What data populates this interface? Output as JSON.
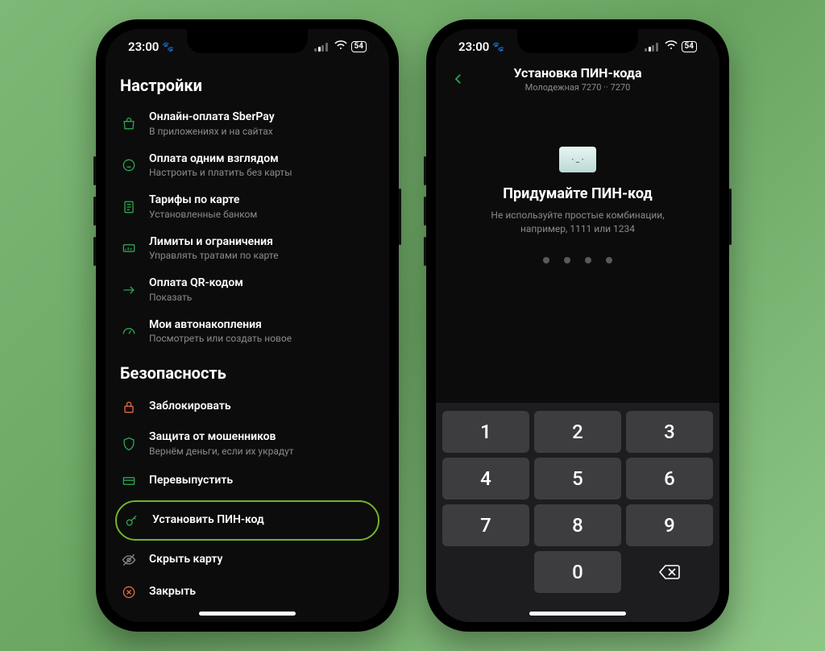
{
  "status": {
    "time": "23:00",
    "battery": "54"
  },
  "screen1": {
    "section1_title": "Настройки",
    "items1": [
      {
        "title": "Онлайн-оплата SberPay",
        "subtitle": "В приложениях и на сайтах"
      },
      {
        "title": "Оплата одним взглядом",
        "subtitle": "Настроить и платить без карты"
      },
      {
        "title": "Тарифы по карте",
        "subtitle": "Установленные банком"
      },
      {
        "title": "Лимиты и ограничения",
        "subtitle": "Управлять тратами по карте"
      },
      {
        "title": "Оплата QR-кодом",
        "subtitle": "Показать"
      },
      {
        "title": "Мои автонакопления",
        "subtitle": "Посмотреть или создать новое"
      }
    ],
    "section2_title": "Безопасность",
    "items2": [
      {
        "title": "Заблокировать",
        "subtitle": ""
      },
      {
        "title": "Защита от мошенников",
        "subtitle": "Вернём деньги, если их украдут"
      },
      {
        "title": "Перевыпустить",
        "subtitle": ""
      },
      {
        "title": "Установить ПИН-код",
        "subtitle": ""
      },
      {
        "title": "Скрыть карту",
        "subtitle": ""
      },
      {
        "title": "Закрыть",
        "subtitle": ""
      }
    ]
  },
  "screen2": {
    "nav_title": "Установка ПИН-кода",
    "nav_subtitle": "Молодежная 7270 ·· 7270",
    "heading": "Придумайте ПИН-код",
    "hint1": "Не используйте простые комбинации,",
    "hint2": "например, 1111 или 1234",
    "keys": [
      "1",
      "2",
      "3",
      "4",
      "5",
      "6",
      "7",
      "8",
      "9",
      "",
      "0",
      "del"
    ]
  }
}
